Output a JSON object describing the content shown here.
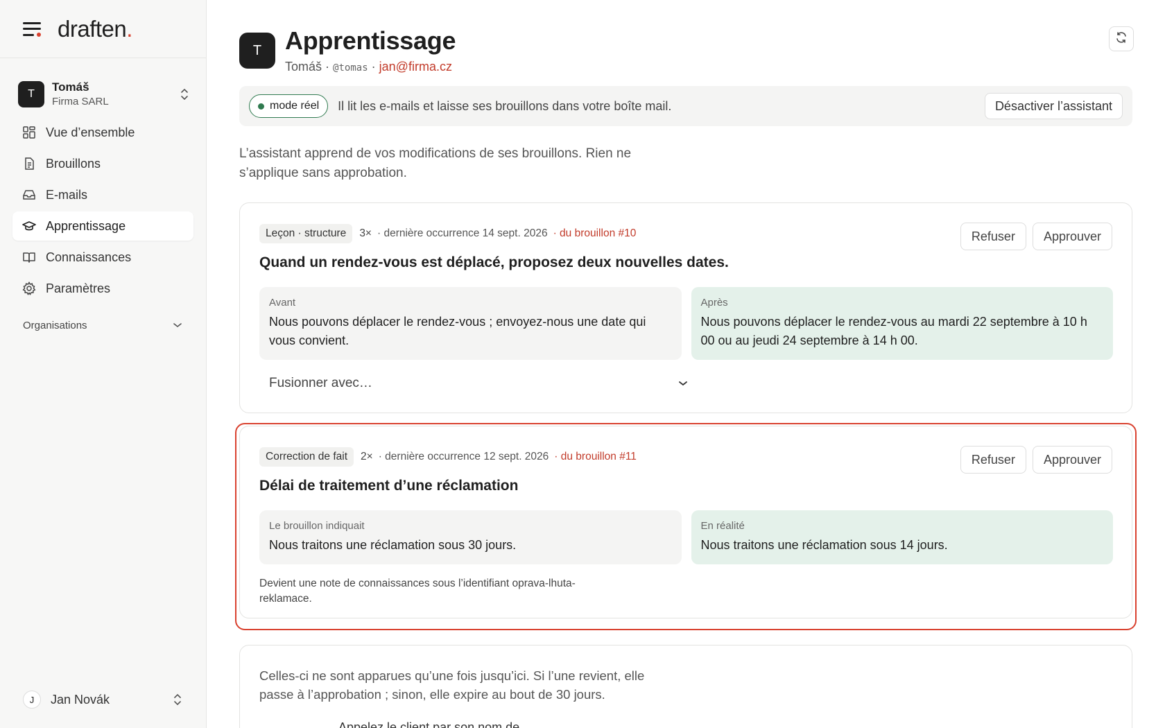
{
  "brand": {
    "logo_text": "draften",
    "logo_dot": "."
  },
  "workspace": {
    "avatar_letter": "T",
    "name": "Tomáš",
    "org": "Firma SARL"
  },
  "nav": {
    "items": [
      {
        "label": "Vue d’ensemble",
        "icon": "dashboard-icon"
      },
      {
        "label": "Brouillons",
        "icon": "document-icon"
      },
      {
        "label": "E-mails",
        "icon": "inbox-icon"
      },
      {
        "label": "Apprentissage",
        "icon": "graduation-cap-icon",
        "active": true
      },
      {
        "label": "Connaissances",
        "icon": "book-icon"
      },
      {
        "label": "Paramètres",
        "icon": "gear-icon"
      }
    ],
    "organisations_label": "Organisations"
  },
  "user": {
    "avatar_letter": "J",
    "name": "Jan Novák"
  },
  "header": {
    "avatar_letter": "T",
    "title": "Apprentissage",
    "name": "Tomáš",
    "separator": "·",
    "handle": "@tomas",
    "email": "jan@firma.cz"
  },
  "status": {
    "mode_label": "mode réel",
    "text": "Il lit les e-mails et laisse ses brouillons dans votre boîte mail.",
    "deactivate_label": "Désactiver l’assistant"
  },
  "intro": "L’assistant apprend de vos modifications de ses brouillons. Rien ne s’applique sans approbation.",
  "lessons": [
    {
      "tag": "Leçon · structure",
      "count": "3×",
      "last": "· dernière occurrence 14 sept. 2026",
      "draft_link": "· du brouillon #10",
      "title": "Quand un rendez-vous est déplacé, proposez deux nouvelles dates.",
      "before_label": "Avant",
      "before_text": "Nous pouvons déplacer le rendez-vous ; envoyez-nous une date qui vous convient.",
      "after_label": "Après",
      "after_text": "Nous pouvons déplacer le rendez-vous au mardi 22 septembre à 10 h 00 ou au jeudi 24 septembre à 14 h 00.",
      "merge_placeholder": "Fusionner avec…",
      "refuse_label": "Refuser",
      "approve_label": "Approuver"
    },
    {
      "tag": "Correction de fait",
      "count": "2×",
      "last": "· dernière occurrence 12 sept. 2026",
      "draft_link": "· du brouillon #11",
      "title": "Délai de traitement d’une réclamation",
      "before_label": "Le brouillon indiquait",
      "before_text": "Nous traitons une réclamation sous 30 jours.",
      "after_label": "En réalité",
      "after_text": "Nous traitons une réclamation sous 14 jours.",
      "note": "Devient une note de connaissances sous l’identifiant oprava-lhuta-reklamace.",
      "refuse_label": "Refuser",
      "approve_label": "Approuver"
    }
  ],
  "pending": {
    "text": "Celles-ci ne sont apparues qu’une fois jusqu’ici. Si l’une revient, elle passe à l’approbation ; sinon, elle expire au bout de 30 jours.",
    "peek_text": "Appelez le client par son nom de"
  },
  "colors": {
    "accent": "#d9412f",
    "live": "#2f7a4f",
    "after_bg": "#e4f1ea"
  }
}
